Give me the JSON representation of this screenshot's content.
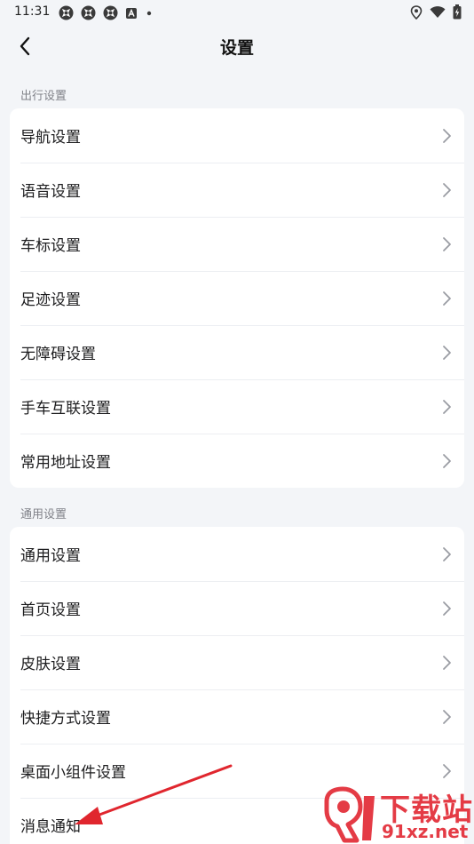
{
  "status_bar": {
    "time": "11:31",
    "left_icons": [
      "app-notification-icon",
      "app-notification-icon",
      "app-notification-icon",
      "keyboard-a-icon",
      "dot-icon"
    ],
    "right_icons": [
      "location-icon",
      "wifi-icon",
      "battery-charging-icon"
    ]
  },
  "header": {
    "title": "设置",
    "back_icon": "chevron-left-icon"
  },
  "sections": [
    {
      "label": "出行设置",
      "items": [
        {
          "label": "导航设置"
        },
        {
          "label": "语音设置"
        },
        {
          "label": "车标设置"
        },
        {
          "label": "足迹设置"
        },
        {
          "label": "无障碍设置"
        },
        {
          "label": "手车互联设置"
        },
        {
          "label": "常用地址设置"
        }
      ]
    },
    {
      "label": "通用设置",
      "items": [
        {
          "label": "通用设置"
        },
        {
          "label": "首页设置"
        },
        {
          "label": "皮肤设置"
        },
        {
          "label": "快捷方式设置"
        },
        {
          "label": "桌面小组件设置"
        },
        {
          "label": "消息通知"
        }
      ]
    }
  ],
  "watermark": {
    "top_text": "下载站",
    "bottom_text": "91xz.net",
    "color": "#e43b45"
  },
  "annotation": {
    "arrow_color": "#e0262e"
  }
}
